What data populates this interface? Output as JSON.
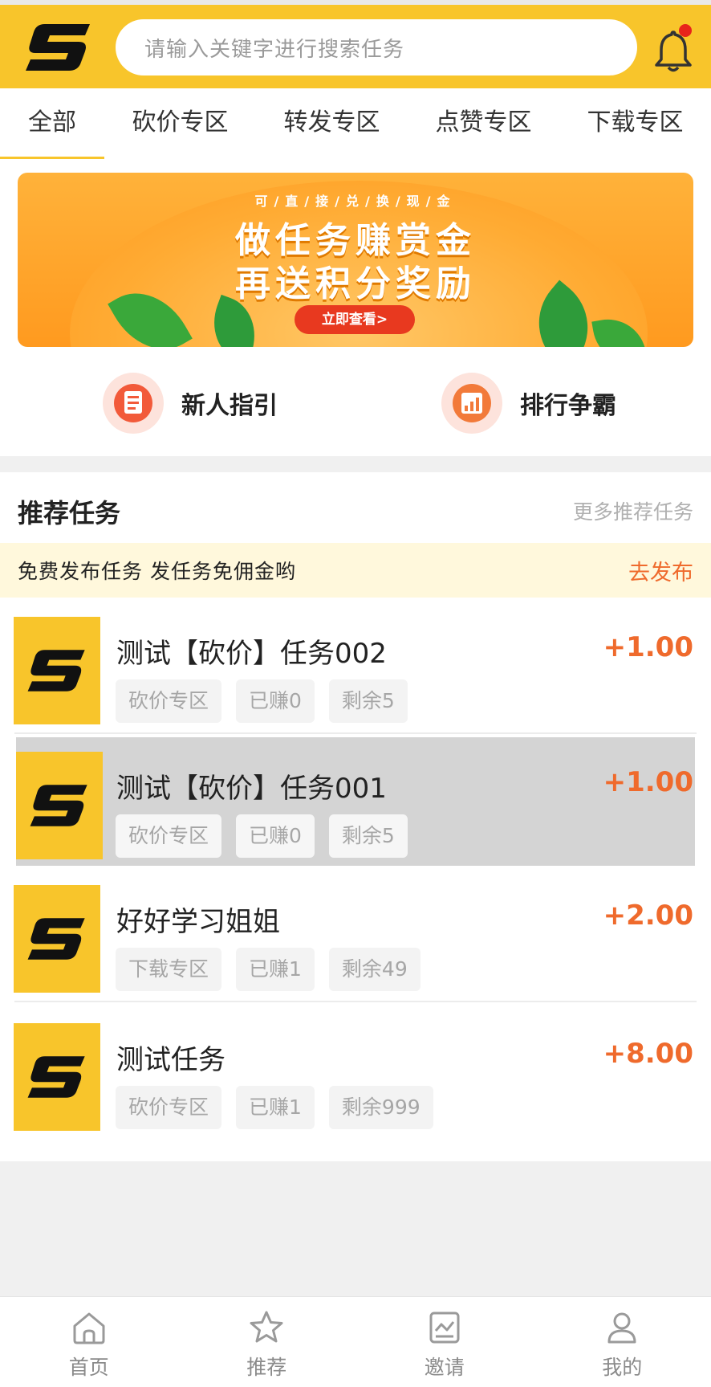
{
  "search": {
    "placeholder": "请输入关键字进行搜索任务"
  },
  "tabs": [
    {
      "label": "全部",
      "active": true
    },
    {
      "label": "砍价专区"
    },
    {
      "label": "转发专区"
    },
    {
      "label": "点赞专区"
    },
    {
      "label": "下载专区"
    }
  ],
  "banner": {
    "subtitle": "可/直/接/兑/换/现/金",
    "line1": "做任务赚赏金",
    "line2": "再送积分奖励",
    "button": "立即查看>"
  },
  "quick": {
    "guide": "新人指引",
    "rank": "排行争霸"
  },
  "recommend": {
    "title": "推荐任务",
    "more": "更多推荐任务",
    "notice": "免费发布任务 发任务免佣金哟",
    "publish": "去发布"
  },
  "tasks": [
    {
      "title": "测试【砍价】任务002",
      "price": "+1.00",
      "category": "砍价专区",
      "earned": "已赚0",
      "remaining": "剩余5"
    },
    {
      "title": "测试【砍价】任务001",
      "price": "+1.00",
      "category": "砍价专区",
      "earned": "已赚0",
      "remaining": "剩余5"
    },
    {
      "title": "好好学习姐姐",
      "price": "+2.00",
      "category": "下载专区",
      "earned": "已赚1",
      "remaining": "剩余49"
    },
    {
      "title": "测试任务",
      "price": "+8.00",
      "category": "砍价专区",
      "earned": "已赚1",
      "remaining": "剩余999"
    }
  ],
  "nav": [
    {
      "label": "首页",
      "icon": "home-icon"
    },
    {
      "label": "推荐",
      "icon": "star-icon"
    },
    {
      "label": "邀请",
      "icon": "chart-icon"
    },
    {
      "label": "我的",
      "icon": "user-icon"
    }
  ],
  "colors": {
    "brand": "#f8c52b",
    "accent": "#ef6a2c",
    "notice_bg": "#fff8dc"
  }
}
